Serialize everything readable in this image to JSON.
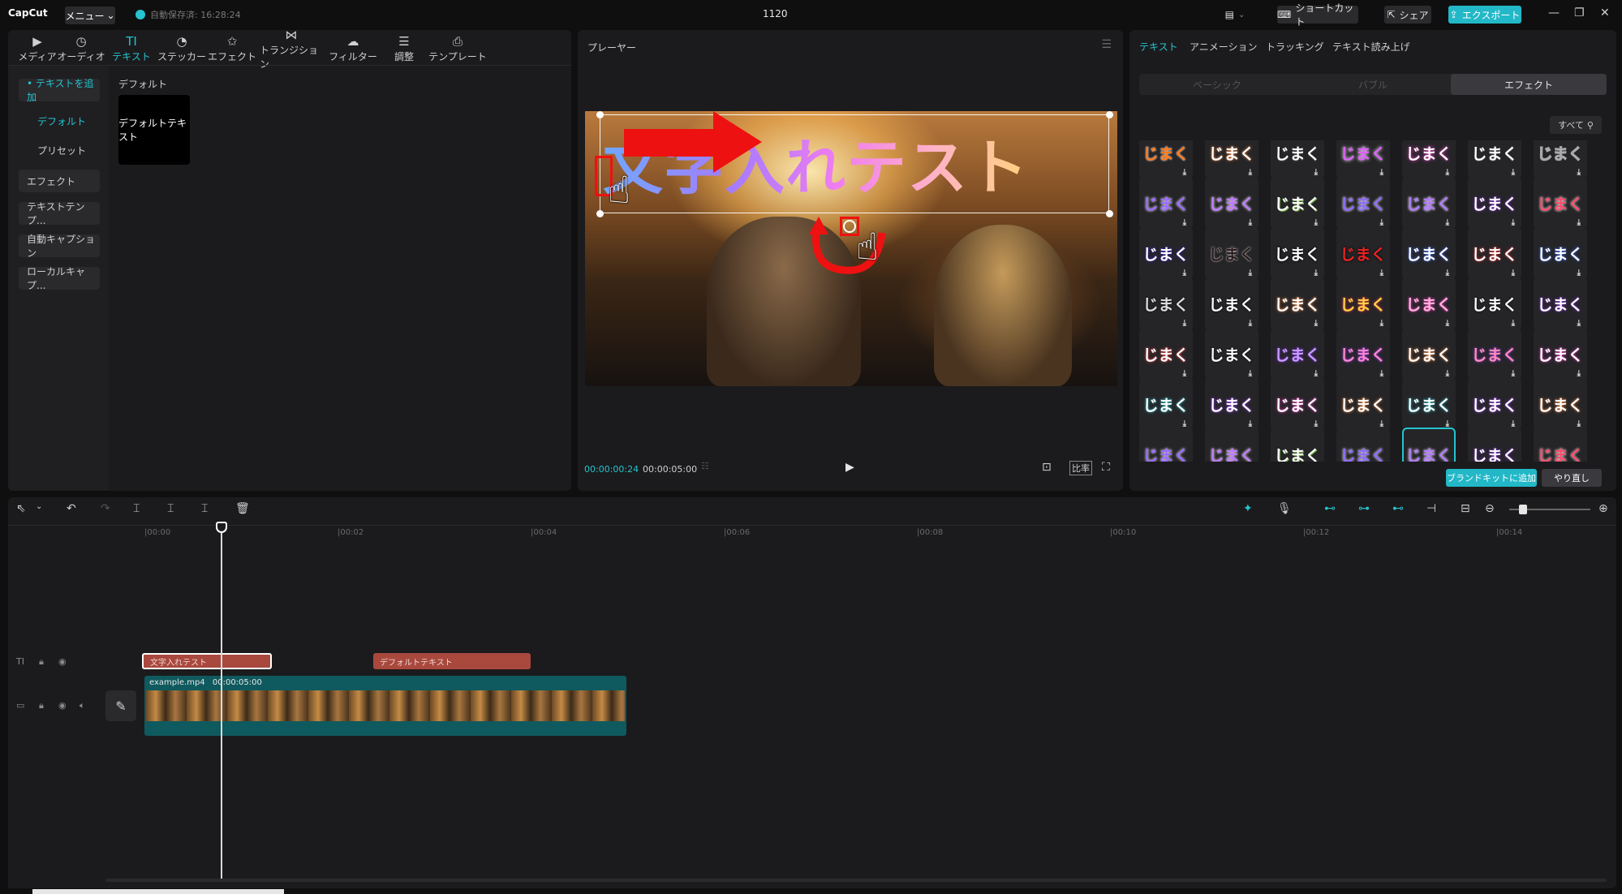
{
  "titlebar": {
    "logo": "CapCut",
    "menu_label": "メニュー",
    "autosave": "自動保存済: 16:28:24",
    "project_title": "1120",
    "shortcut_label": "ショートカット",
    "share_label": "シェア",
    "export_label": "エクスポート"
  },
  "toolbar_tabs": [
    {
      "label": "メディア",
      "icon": "media-icon"
    },
    {
      "label": "オーディオ",
      "icon": "audio-icon"
    },
    {
      "label": "テキスト",
      "icon": "text-icon"
    },
    {
      "label": "ステッカー",
      "icon": "sticker-icon"
    },
    {
      "label": "エフェクト",
      "icon": "effect-icon"
    },
    {
      "label": "トランジション",
      "icon": "transition-icon"
    },
    {
      "label": "フィルター",
      "icon": "filter-icon"
    },
    {
      "label": "調整",
      "icon": "adjust-icon"
    },
    {
      "label": "テンプレート",
      "icon": "template-icon"
    }
  ],
  "active_tab": "テキスト",
  "sidebar": {
    "items": [
      {
        "label": "• テキストを追加"
      },
      {
        "label": "デフォルト"
      },
      {
        "label": "プリセット"
      },
      {
        "label": "エフェクト"
      },
      {
        "label": "テキストテンプ..."
      },
      {
        "label": "自動キャプション"
      },
      {
        "label": "ローカルキャプ..."
      }
    ]
  },
  "library": {
    "section_label": "デフォルト",
    "default_item": "デフォルトテキスト"
  },
  "player": {
    "title": "プレーヤー",
    "overlay_text": "文字入れテスト",
    "current_time": "00:00:00:24",
    "total_time": "00:00:05:00",
    "ratio_label": "比率"
  },
  "props": {
    "tabs": [
      "テキスト",
      "アニメーション",
      "トラッキング",
      "テキスト読み上げ"
    ],
    "segments": [
      "ベーシック",
      "バブル",
      "エフェクト"
    ],
    "filter_label": "すべて",
    "effect_label": "じまく",
    "brand_button": "ブランドキットに追加",
    "redo_button": "やり直し",
    "accent_color": "#25c4cf"
  },
  "timeline": {
    "ruler": [
      "|00:00",
      "|00:02",
      "|00:04",
      "|00:06",
      "|00:08",
      "|00:10",
      "|00:12",
      "|00:14"
    ],
    "text_clips": [
      "文字入れテスト",
      "デフォルトテキスト"
    ],
    "video_clip_name": "example.mp4",
    "video_clip_duration": "00:00:05:00"
  }
}
